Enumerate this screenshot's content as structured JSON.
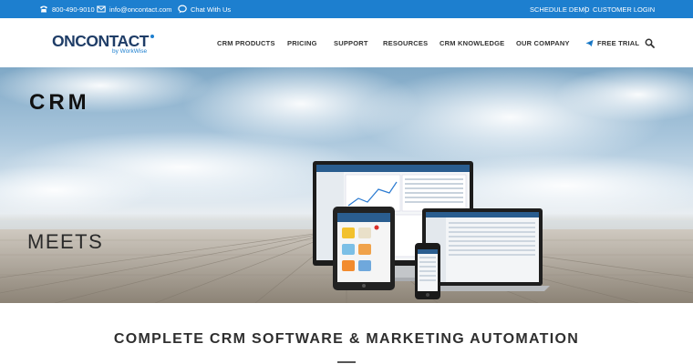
{
  "topbar": {
    "phone": "800-490-9010",
    "email": "info@oncontact.com",
    "chat": "Chat With Us",
    "schedule_demo": "SCHEDULE DEMO",
    "separator": "|",
    "customer_login": "CUSTOMER LOGIN"
  },
  "logo": {
    "on": "ON",
    "contact": "CONTACT",
    "byline": "by WorkWise"
  },
  "nav": {
    "items": [
      "CRM PRODUCTS",
      "PRICING",
      "SUPPORT",
      "RESOURCES",
      "CRM KNOWLEDGE",
      "OUR COMPANY"
    ],
    "free_trial": "FREE TRIAL"
  },
  "hero": {
    "title": "CRM",
    "subtitle": "MEETS"
  },
  "section": {
    "headline": "COMPLETE CRM SOFTWARE & MARKETING AUTOMATION"
  },
  "colors": {
    "topbar": "#1d7fcf",
    "logo_primary": "#1f3d67",
    "accent": "#1d7fcf"
  }
}
